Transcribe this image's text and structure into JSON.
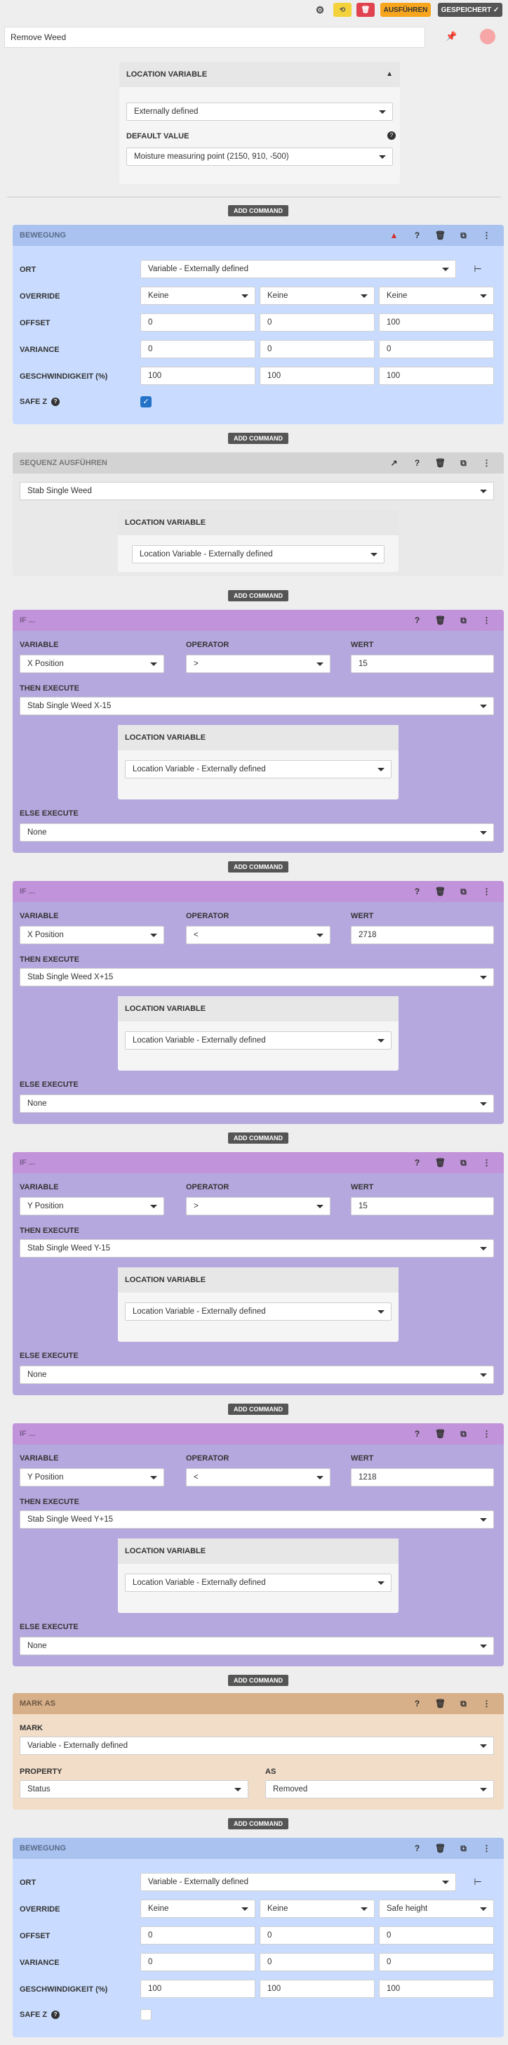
{
  "toolbar": {
    "gear_icon": "gear-icon",
    "run_label": "AUSFÜHREN",
    "saved_label": "GESPEICHERT ✓"
  },
  "sequence_name": "Remove Weed",
  "location_variable_panel": {
    "title": "LOCATION VARIABLE",
    "mode": "Externally defined",
    "default_value_label": "DEFAULT VALUE",
    "default_value": "Moisture measuring point (2150, 910, -500)"
  },
  "add_command_label": "ADD COMMAND",
  "move1": {
    "title": "BEWEGUNG",
    "ort_label": "ORT",
    "ort_value": "Variable - Externally defined",
    "override_label": "OVERRIDE",
    "override": [
      "Keine",
      "Keine",
      "Keine"
    ],
    "offset_label": "OFFSET",
    "offset": [
      "0",
      "0",
      "100"
    ],
    "variance_label": "VARIANCE",
    "variance": [
      "0",
      "0",
      "0"
    ],
    "speed_label": "GESCHWINDIGKEIT (%)",
    "speed": [
      "100",
      "100",
      "100"
    ],
    "safe_z_label": "SAFE Z"
  },
  "exec": {
    "title": "SEQUENZ AUSFÜHREN",
    "sequence": "Stab Single Weed",
    "loc_title": "LOCATION VARIABLE",
    "loc_value": "Location Variable - Externally defined"
  },
  "ifs": [
    {
      "title": "IF ...",
      "variable_label": "VARIABLE",
      "variable": "X Position",
      "operator_label": "OPERATOR",
      "operator": ">",
      "value_label": "WERT",
      "value": "15",
      "then_label": "THEN EXECUTE",
      "then": "Stab Single Weed X-15",
      "loc_title": "LOCATION VARIABLE",
      "loc_value": "Location Variable - Externally defined",
      "else_label": "ELSE EXECUTE",
      "else": "None"
    },
    {
      "title": "IF ...",
      "variable_label": "VARIABLE",
      "variable": "X Position",
      "operator_label": "OPERATOR",
      "operator": "<",
      "value_label": "WERT",
      "value": "2718",
      "then_label": "THEN EXECUTE",
      "then": "Stab Single Weed X+15",
      "loc_title": "LOCATION VARIABLE",
      "loc_value": "Location Variable - Externally defined",
      "else_label": "ELSE EXECUTE",
      "else": "None"
    },
    {
      "title": "IF ...",
      "variable_label": "VARIABLE",
      "variable": "Y Position",
      "operator_label": "OPERATOR",
      "operator": ">",
      "value_label": "WERT",
      "value": "15",
      "then_label": "THEN EXECUTE",
      "then": "Stab Single Weed Y-15",
      "loc_title": "LOCATION VARIABLE",
      "loc_value": "Location Variable - Externally defined",
      "else_label": "ELSE EXECUTE",
      "else": "None"
    },
    {
      "title": "IF ...",
      "variable_label": "VARIABLE",
      "variable": "Y Position",
      "operator_label": "OPERATOR",
      "operator": "<",
      "value_label": "WERT",
      "value": "1218",
      "then_label": "THEN EXECUTE",
      "then": "Stab Single Weed Y+15",
      "loc_title": "LOCATION VARIABLE",
      "loc_value": "Location Variable - Externally defined",
      "else_label": "ELSE EXECUTE",
      "else": "None"
    }
  ],
  "mark": {
    "title": "MARK AS",
    "mark_label": "MARK",
    "mark_value": "Variable - Externally defined",
    "property_label": "PROPERTY",
    "property": "Status",
    "as_label": "AS",
    "as": "Removed"
  },
  "move2": {
    "title": "BEWEGUNG",
    "ort_label": "ORT",
    "ort_value": "Variable - Externally defined",
    "override_label": "OVERRIDE",
    "override": [
      "Keine",
      "Keine",
      "Safe height"
    ],
    "offset_label": "OFFSET",
    "offset": [
      "0",
      "0",
      "0"
    ],
    "variance_label": "VARIANCE",
    "variance": [
      "0",
      "0",
      "0"
    ],
    "speed_label": "GESCHWINDIGKEIT (%)",
    "speed": [
      "100",
      "100",
      "100"
    ],
    "safe_z_label": "SAFE Z"
  }
}
